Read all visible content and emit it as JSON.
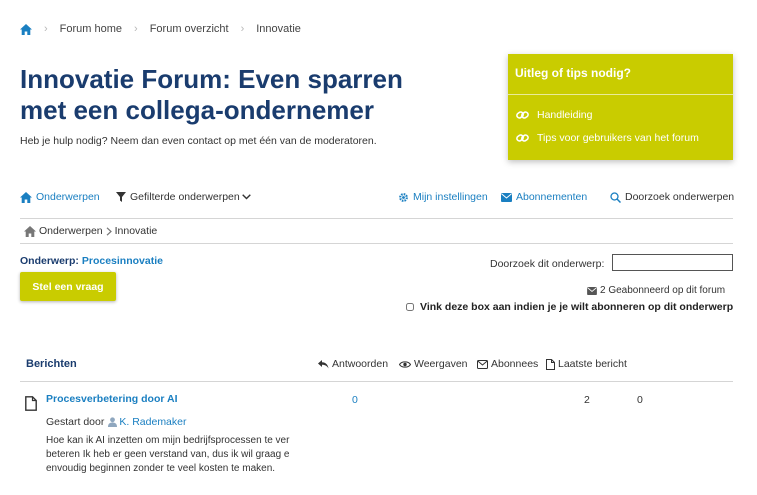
{
  "breadcrumb": {
    "items": [
      "Forum home",
      "Forum overzicht",
      "Innovatie"
    ]
  },
  "page": {
    "title": "Innovatie Forum: Even sparren met een collega-ondernemer",
    "subtitle": "Heb je hulp nodig? Neem dan even contact op met één van de moderatoren."
  },
  "tips": {
    "title": "Uitleg of tips nodig?",
    "links": [
      "Handleiding",
      "Tips voor gebruikers van het forum"
    ]
  },
  "toolbar": {
    "topics": "Onderwerpen",
    "filtered": "Gefilterde onderwerpen",
    "settings": "Mijn instellingen",
    "subscriptions": "Abonnementen",
    "search": "Doorzoek onderwerpen"
  },
  "sub_breadcrumb": {
    "home": "Onderwerpen",
    "current": "Innovatie"
  },
  "topic": {
    "label": "Onderwerp:",
    "name": "Procesinnovatie"
  },
  "search_topic": {
    "label": "Doorzoek dit onderwerp:",
    "value": ""
  },
  "ask_button": "Stel een vraag",
  "subscribed_text": "2 Geabonneerd op dit forum",
  "subscribe_checkbox": "Vink deze box aan indien je je wilt abonneren op dit onderwerp",
  "table": {
    "heading": "Berichten",
    "columns": [
      "Antwoorden",
      "Weergaven",
      "Abonnees",
      "Laatste bericht"
    ],
    "rows": [
      {
        "title": "Procesverbetering door AI",
        "replies": "0",
        "views": "2",
        "subscribers": "0",
        "started_label": "Gestart door",
        "author": "K. Rademaker",
        "excerpt": "Hoe kan ik AI inzetten om mijn bedrijfsprocessen te ver beteren Ik heb er geen verstand van, dus ik wil graag e envoudig beginnen zonder te veel kosten te maken."
      }
    ]
  },
  "colors": {
    "brand": "#1a3c6e",
    "link": "#1a7fc1",
    "accent": "#c9cc00"
  }
}
